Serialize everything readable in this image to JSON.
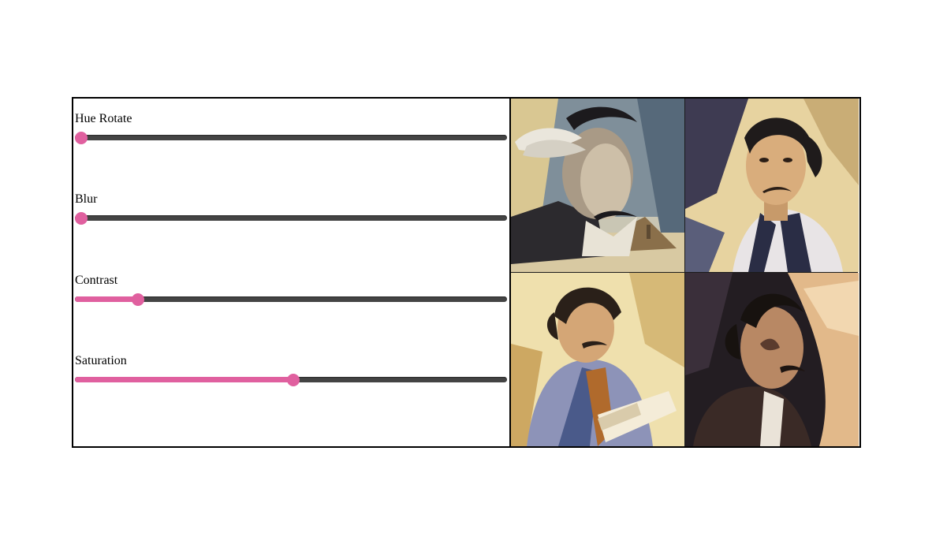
{
  "colors": {
    "accent": "#e0609f",
    "track": "#444444",
    "border": "#000000"
  },
  "controls": [
    {
      "label": "Hue Rotate",
      "value": 0.0
    },
    {
      "label": "Blur",
      "value": 0.0
    },
    {
      "label": "Contrast",
      "value": 0.135
    },
    {
      "label": "Saturation",
      "value": 0.505
    }
  ],
  "gallery": {
    "images": [
      {
        "icon": "surreal-portrait-with-clouds-image"
      },
      {
        "icon": "portrait-in-white-suit-image"
      },
      {
        "icon": "portrait-reading-book-image"
      },
      {
        "icon": "profile-portrait-dark-image"
      }
    ]
  }
}
